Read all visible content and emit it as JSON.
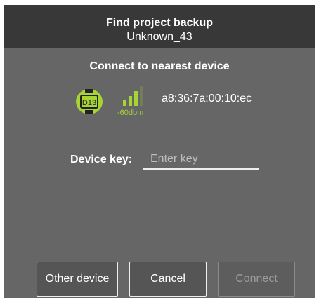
{
  "dialog": {
    "title": "Find project backup",
    "subtitle": "Unknown_43",
    "section_title": "Connect to nearest device"
  },
  "device": {
    "badge_label": "D13",
    "signal_text": "-60dbm",
    "signal_bars_active": 3,
    "signal_bars_total": 4,
    "mac_address": "a8:36:7a:00:10:ec",
    "icon": "device-badge-icon",
    "accent_color": "#a6d435"
  },
  "device_key": {
    "label": "Device key:",
    "value": "",
    "placeholder": "Enter key"
  },
  "buttons": {
    "other_device": "Other device",
    "cancel": "Cancel",
    "connect": "Connect"
  },
  "colors": {
    "header_bg": "#383838",
    "dialog_bg": "#666666",
    "accent": "#a6d435"
  }
}
